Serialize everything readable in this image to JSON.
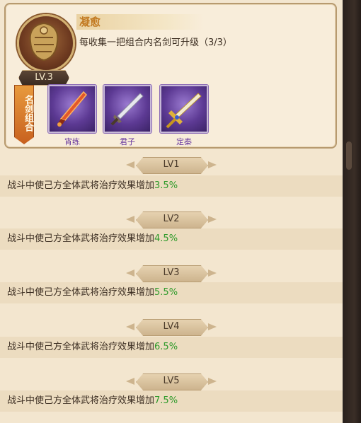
{
  "skill": {
    "level": "LV.3",
    "title": "凝愈",
    "description": "每收集一把组合内名剑可升级（3/3）"
  },
  "combo_banner": "名剑组合",
  "swords": [
    {
      "name": "宵练",
      "icon": "flame-sword-icon"
    },
    {
      "name": "君子",
      "icon": "silver-sword-icon"
    },
    {
      "name": "定秦",
      "icon": "golden-sword-icon"
    }
  ],
  "levels": [
    {
      "label": "LV1",
      "text": "战斗中使己方全体武将治疗效果增加",
      "value": "3.5%"
    },
    {
      "label": "LV2",
      "text": "战斗中使己方全体武将治疗效果增加",
      "value": "4.5%"
    },
    {
      "label": "LV3",
      "text": "战斗中使己方全体武将治疗效果增加",
      "value": "5.5%"
    },
    {
      "label": "LV4",
      "text": "战斗中使己方全体武将治疗效果增加",
      "value": "6.5%"
    },
    {
      "label": "LV5",
      "text": "战斗中使己方全体武将治疗效果增加",
      "value": "7.5%"
    }
  ],
  "colors": {
    "highlight_value": "#2e9a2a",
    "title": "#c27a22",
    "sword_name": "#6a3aa0"
  }
}
